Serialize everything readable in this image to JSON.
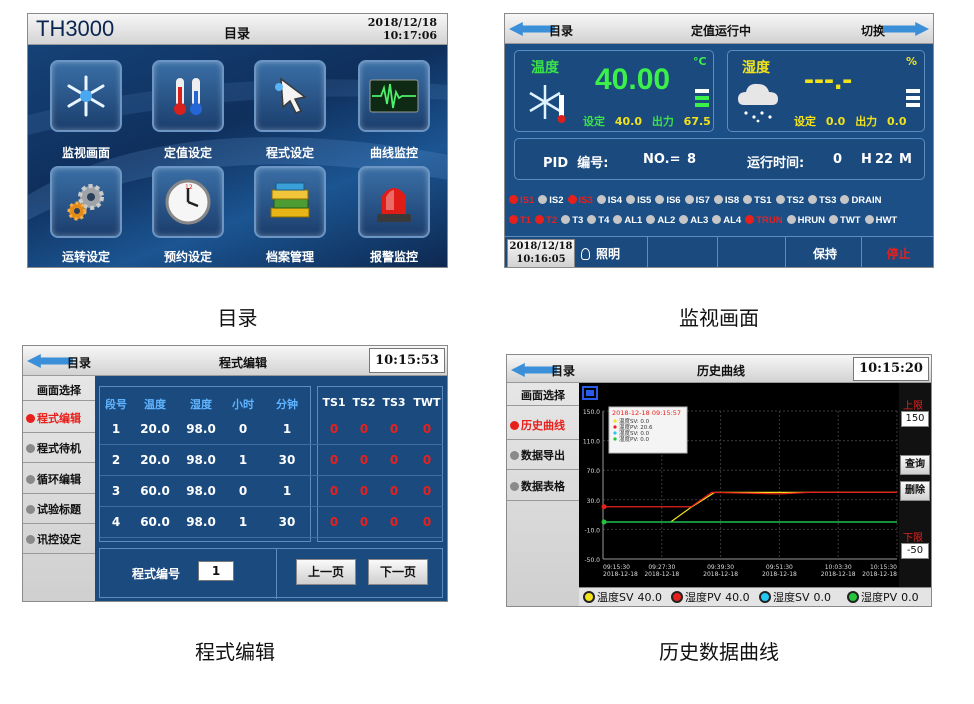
{
  "menu_panel": {
    "brand": "TH3000",
    "title": "目录",
    "date": "2018/12/18",
    "time": "10:17:06",
    "items": [
      {
        "label": "监视画面",
        "icon": "snowflake-icon"
      },
      {
        "label": "定值设定",
        "icon": "thermometer-icon"
      },
      {
        "label": "程式设定",
        "icon": "hand-pointer-icon"
      },
      {
        "label": "曲线监控",
        "icon": "waveform-icon"
      },
      {
        "label": "运转设定",
        "icon": "gears-icon"
      },
      {
        "label": "预约设定",
        "icon": "clock-icon"
      },
      {
        "label": "档案管理",
        "icon": "books-icon"
      },
      {
        "label": "报警监控",
        "icon": "alarm-light-icon"
      }
    ]
  },
  "monitor_panel": {
    "back_label": "目录",
    "status": "定值运行中",
    "switch_label": "切换",
    "temperature": {
      "label": "温度",
      "value": "40.00",
      "unit": "°C",
      "set_label": "设定",
      "set": "40.0",
      "output_label": "出力",
      "output": "67.5"
    },
    "humidity": {
      "label": "湿度",
      "value": "---.-",
      "unit": "%",
      "set_label": "设定",
      "set": "0.0",
      "output_label": "出力",
      "output": "0.0"
    },
    "pid": {
      "label": "PID  编号:",
      "no_label": "NO.=",
      "no": "8",
      "runtime_label": "运行时间:",
      "hours": "0",
      "h_label": "H",
      "minutes": "22",
      "m_label": "M"
    },
    "io_row1": [
      {
        "label": "IS1",
        "state": "red"
      },
      {
        "label": "IS2",
        "state": "gray"
      },
      {
        "label": "IS3",
        "state": "red"
      },
      {
        "label": "IS4",
        "state": "gray"
      },
      {
        "label": "IS5",
        "state": "gray"
      },
      {
        "label": "IS6",
        "state": "gray"
      },
      {
        "label": "IS7",
        "state": "gray"
      },
      {
        "label": "IS8",
        "state": "gray"
      },
      {
        "label": "TS1",
        "state": "gray"
      },
      {
        "label": "TS2",
        "state": "gray"
      },
      {
        "label": "TS3",
        "state": "gray"
      },
      {
        "label": "DRAIN",
        "state": "gray"
      }
    ],
    "io_row2": [
      {
        "label": "T1",
        "state": "red"
      },
      {
        "label": "T2",
        "state": "red"
      },
      {
        "label": "T3",
        "state": "gray"
      },
      {
        "label": "T4",
        "state": "gray"
      },
      {
        "label": "AL1",
        "state": "gray"
      },
      {
        "label": "AL2",
        "state": "gray"
      },
      {
        "label": "AL3",
        "state": "gray"
      },
      {
        "label": "AL4",
        "state": "gray"
      },
      {
        "label": "TRUN",
        "state": "red"
      },
      {
        "label": "HRUN",
        "state": "gray"
      },
      {
        "label": "TWT",
        "state": "gray"
      },
      {
        "label": "HWT",
        "state": "gray"
      }
    ],
    "date": "2018/12/18",
    "time": "10:16:05",
    "light_label": "照明",
    "hold_label": "保持",
    "stop_label": "停止"
  },
  "program_panel": {
    "back_label": "目录",
    "title": "程式编辑",
    "time": "10:15:53",
    "side_header": "画面选择",
    "side_items": [
      {
        "label": "程式编辑",
        "active": true
      },
      {
        "label": "程式待机",
        "active": false
      },
      {
        "label": "循环编辑",
        "active": false
      },
      {
        "label": "试验标题",
        "active": false
      },
      {
        "label": "讯控设定",
        "active": false
      }
    ],
    "columns": [
      "段号",
      "温度",
      "湿度",
      "小时",
      "分钟"
    ],
    "ts_columns": [
      "TS1",
      "TS2",
      "TS3",
      "TWT"
    ],
    "rows": [
      {
        "seg": "1",
        "temp": "20.0",
        "hum": "98.0",
        "hour": "0",
        "min": "1",
        "ts": [
          "0",
          "0",
          "0",
          "0"
        ]
      },
      {
        "seg": "2",
        "temp": "20.0",
        "hum": "98.0",
        "hour": "1",
        "min": "30",
        "ts": [
          "0",
          "0",
          "0",
          "0"
        ]
      },
      {
        "seg": "3",
        "temp": "60.0",
        "hum": "98.0",
        "hour": "0",
        "min": "1",
        "ts": [
          "0",
          "0",
          "0",
          "0"
        ]
      },
      {
        "seg": "4",
        "temp": "60.0",
        "hum": "98.0",
        "hour": "1",
        "min": "30",
        "ts": [
          "0",
          "0",
          "0",
          "0"
        ]
      }
    ],
    "program_no_label": "程式编号",
    "program_no": "1",
    "prev_label": "上一页",
    "next_label": "下一页"
  },
  "history_panel": {
    "back_label": "目录",
    "title": "历史曲线",
    "time": "10:15:20",
    "side_header": "画面选择",
    "side_items": [
      {
        "label": "历史曲线",
        "active": true
      },
      {
        "label": "数据导出",
        "active": false
      },
      {
        "label": "数据表格",
        "active": false
      }
    ],
    "upper_label": "上限",
    "upper_value": "150",
    "lower_label": "下限",
    "lower_value": "-50",
    "query_label": "查询",
    "delete_label": "删除",
    "tooltip": {
      "datetime": "2018-12-18 09:15:57",
      "lines": [
        "温度SV: 0.0",
        "温度PV: 20.6",
        "湿度SV: 0.0",
        "湿度PV: 0.0"
      ]
    },
    "legend": [
      {
        "label": "温度SV",
        "value": "40.0",
        "color": "#f2e21c"
      },
      {
        "label": "湿度PV",
        "value": "40.0",
        "color": "#e8201c"
      },
      {
        "label": "湿度SV",
        "value": "0.0",
        "color": "#25c8f0"
      },
      {
        "label": "湿度PV",
        "value": "0.0",
        "color": "#22c53c"
      }
    ]
  },
  "captions": {
    "menu": "目录",
    "monitor": "监视画面",
    "program": "程式编辑",
    "history": "历史数据曲线"
  },
  "chart_data": {
    "type": "line",
    "ylim": [
      -50,
      150
    ],
    "y_ticks": [
      "150.0",
      "110.0",
      "70.0",
      "30.0",
      "-10.0",
      "-50.0"
    ],
    "x_ticks": [
      {
        "time": "09:15:30",
        "date": "2018-12-18"
      },
      {
        "time": "09:27:30",
        "date": "2018-12-18"
      },
      {
        "time": "09:39:30",
        "date": "2018-12-18"
      },
      {
        "time": "09:51:30",
        "date": "2018-12-18"
      },
      {
        "time": "10:03:30",
        "date": "2018-12-18"
      },
      {
        "time": "10:15:30",
        "date": "2018-12-18"
      }
    ],
    "grid": true,
    "series": [
      {
        "name": "温度SV",
        "color": "#f2e21c",
        "points": [
          [
            0.23,
            0
          ],
          [
            0.3,
            20
          ],
          [
            0.38,
            40
          ],
          [
            1.0,
            40
          ]
        ]
      },
      {
        "name": "湿度PV",
        "color": "#e8201c",
        "points": [
          [
            0.0,
            20.6
          ],
          [
            0.3,
            20.6
          ],
          [
            0.37,
            40
          ],
          [
            0.6,
            38
          ],
          [
            0.7,
            40
          ],
          [
            1.0,
            40
          ]
        ]
      },
      {
        "name": "湿度SV",
        "color": "#25c8f0",
        "points": [
          [
            0.0,
            0
          ],
          [
            1.0,
            0
          ]
        ]
      },
      {
        "name": "湿度PV",
        "color": "#22c53c",
        "points": [
          [
            0.0,
            0
          ],
          [
            1.0,
            0
          ]
        ]
      }
    ]
  }
}
